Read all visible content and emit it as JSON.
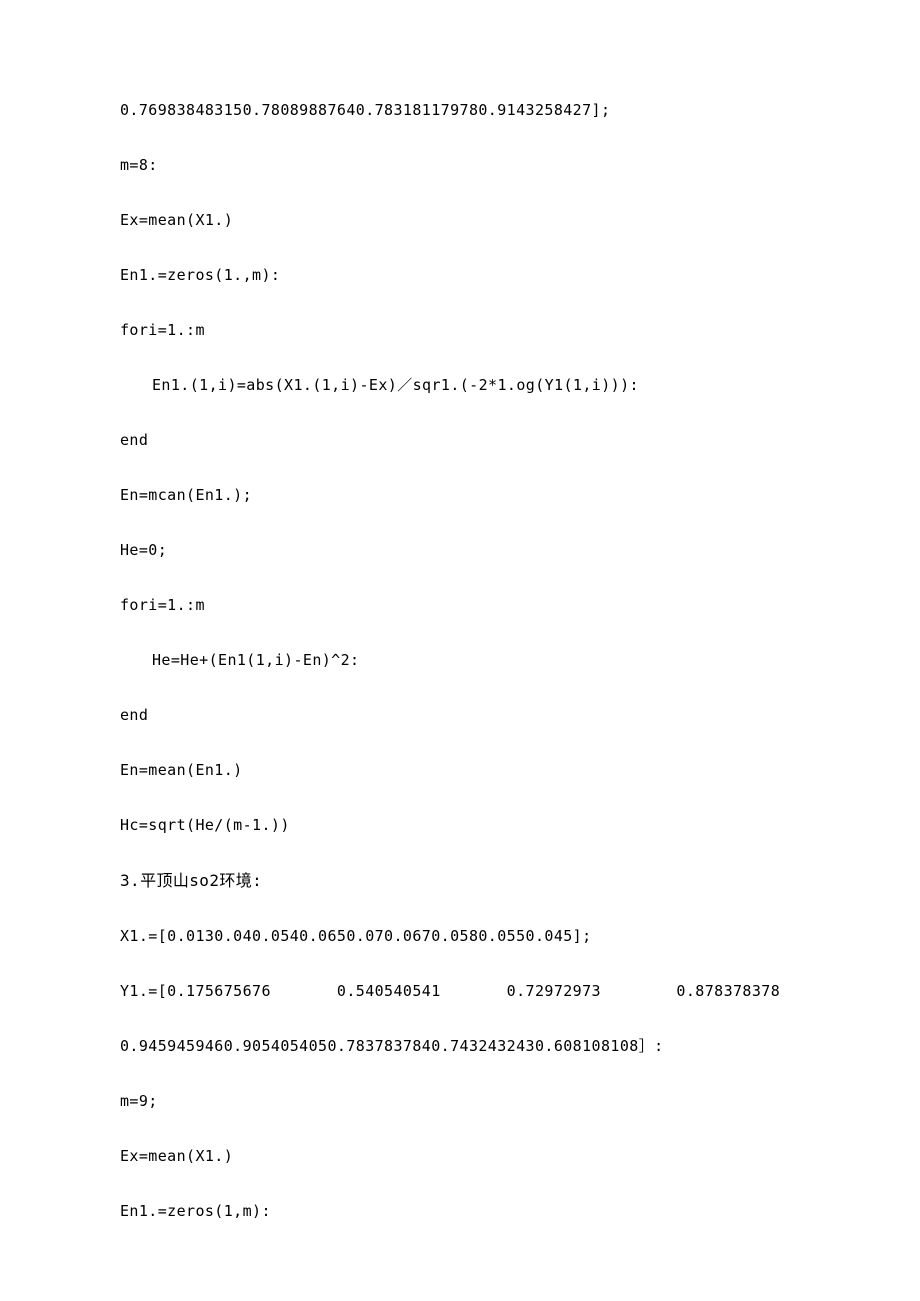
{
  "lines": {
    "l1": "0.769838483150.78089887640.783181179780.9143258427];",
    "l2": "m=8:",
    "l3": "Ex=mean(X1.)",
    "l4": "En1.=zeros(1.,m):",
    "l5": "fori=1.:m",
    "l6": "En1.(1,i)=abs(X1.(1,i)-Ex)／sqr1.(-2*1.og(Y1(1,i))):",
    "l7": "end",
    "l8": "En=mcan(En1.);",
    "l9": "He=0;",
    "l10": "fori=1.:m",
    "l11": "He=He+(En1(1,i)-En)^2:",
    "l12": "end",
    "l13": "En=mean(En1.)",
    "l14": "Hc=sqrt(He/(m-1.))",
    "l15": "3.平顶山so2环境:",
    "l16": "X1.=[0.0130.040.0540.0650.070.0670.0580.0550.045];",
    "l17": "Y1.=[0.175675676       0.540540541       0.72972973        0.878378378",
    "l18": "0.9459459460.9054054050.7837837840.7432432430.608108108］:",
    "l19": "m=9;",
    "l20": "Ex=mean(X1.)",
    "l21": "En1.=zeros(1,m):"
  }
}
